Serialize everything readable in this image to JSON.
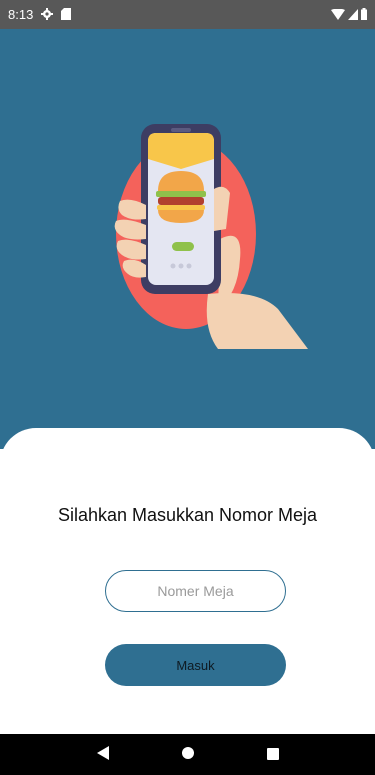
{
  "status_bar": {
    "time": "8:13",
    "icons": [
      "gear-icon",
      "sd-card-icon",
      "wifi-icon",
      "cell-signal-icon",
      "battery-icon"
    ]
  },
  "colors": {
    "primary": "#2f6f91",
    "accent_circle": "#f4625b",
    "status_bar": "#585858"
  },
  "login": {
    "prompt": "Silahkan Masukkan Nomor Meja",
    "table_input": {
      "placeholder": "Nomer Meja",
      "value": ""
    },
    "submit_label": "Masuk"
  },
  "nav_bar": {
    "icons": [
      "back-icon",
      "home-icon",
      "recents-icon"
    ]
  }
}
